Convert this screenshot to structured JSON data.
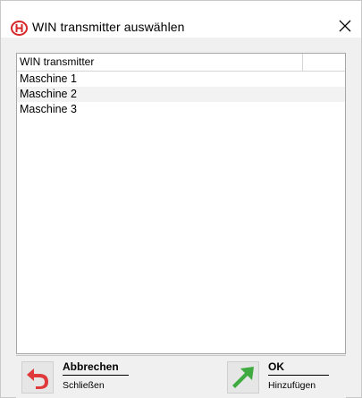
{
  "window": {
    "title": "WIN transmitter auswählen",
    "app_icon": "win-logo-icon",
    "close_icon": "close-icon"
  },
  "list": {
    "columns": [
      "WIN transmitter",
      ""
    ],
    "rows": [
      "Maschine 1",
      "Maschine 2",
      "Maschine 3"
    ]
  },
  "buttons": {
    "cancel": {
      "label": "Abbrechen",
      "sub": "Schließen",
      "icon": "undo-arrow-icon",
      "icon_color": "#e0393c"
    },
    "ok": {
      "label": "OK",
      "sub": "Hinzufügen",
      "icon": "arrow-up-right-icon",
      "icon_color": "#3faa3f"
    }
  },
  "colors": {
    "accent_red": "#d62828",
    "background": "#f0f0f0"
  }
}
